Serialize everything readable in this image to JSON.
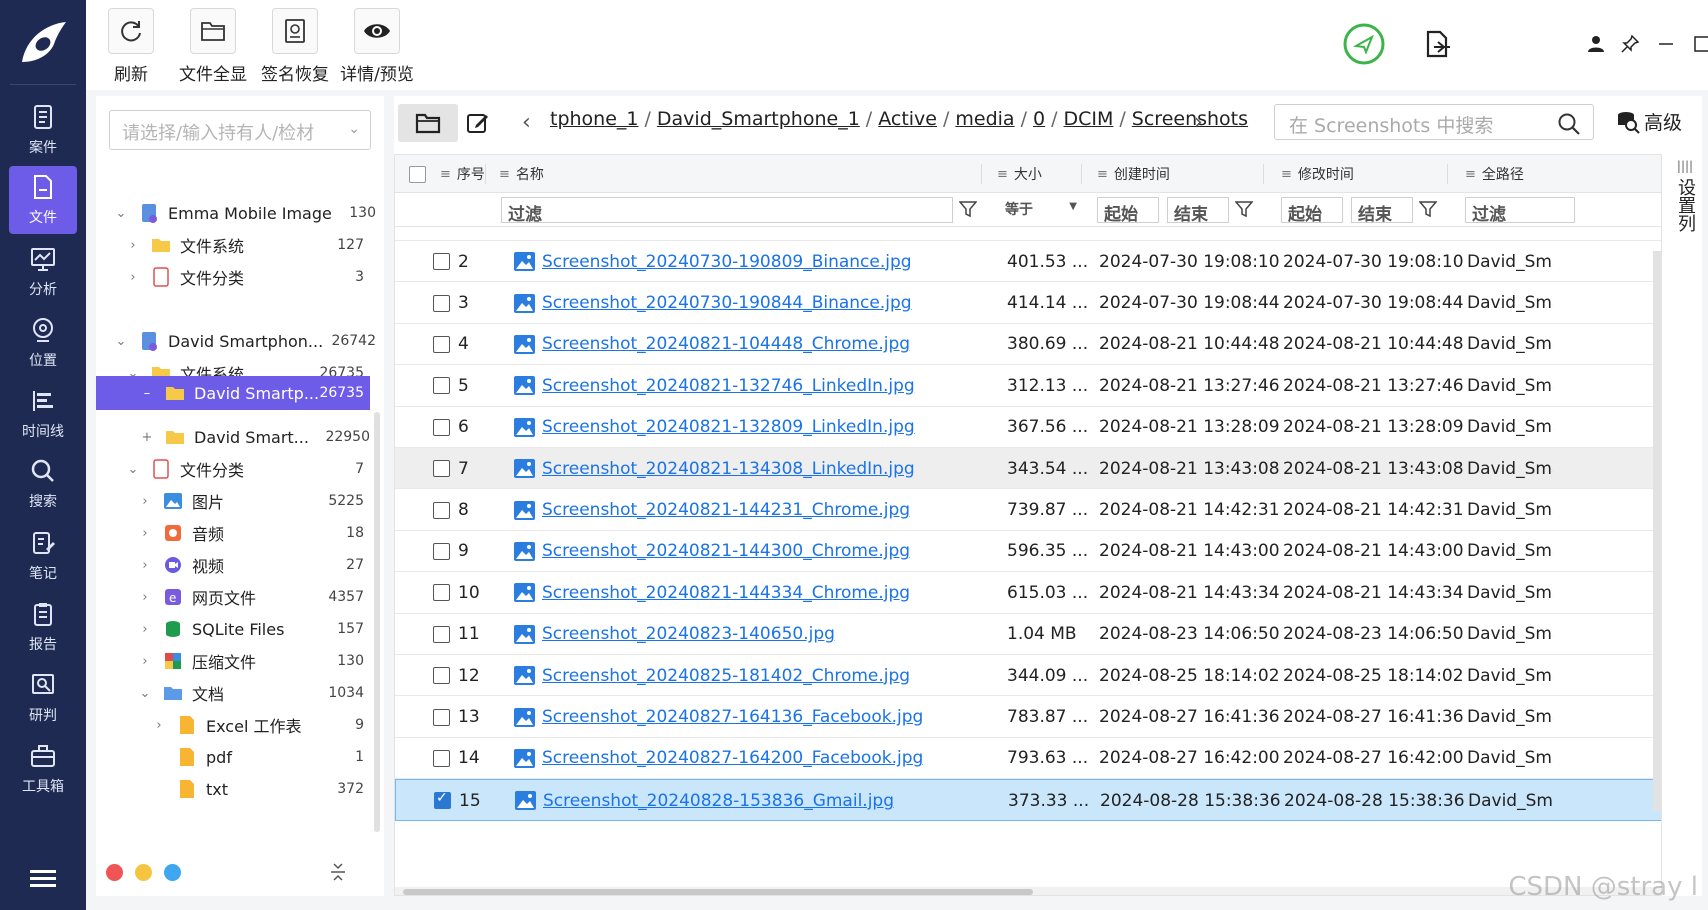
{
  "nav": {
    "items": [
      {
        "label": "案件",
        "icon": "document-icon"
      },
      {
        "label": "文件",
        "icon": "file-icon",
        "active": true
      },
      {
        "label": "分析",
        "icon": "analysis-icon"
      },
      {
        "label": "位置",
        "icon": "location-icon"
      },
      {
        "label": "时间线",
        "icon": "timeline-icon"
      },
      {
        "label": "搜索",
        "icon": "search-icon"
      },
      {
        "label": "笔记",
        "icon": "note-icon"
      },
      {
        "label": "报告",
        "icon": "report-icon"
      },
      {
        "label": "研判",
        "icon": "judge-icon"
      },
      {
        "label": "工具箱",
        "icon": "toolbox-icon"
      }
    ]
  },
  "toolbar": {
    "refresh_label": "刷新",
    "file_overview_label": "文件全显",
    "signature_recover_label": "签名恢复",
    "detail_preview_label": "详情/预览"
  },
  "tree": {
    "search_placeholder": "请选择/输入持有人/检材",
    "nodes": [
      {
        "label": "Emma Mobile Image",
        "count": "130"
      },
      {
        "label": "文件系统",
        "count": "127"
      },
      {
        "label": "文件分类",
        "count": "3"
      },
      {
        "label": "David Smartphon...",
        "count": "26742"
      },
      {
        "label": "文件系统",
        "count": "26735"
      },
      {
        "label": "David Smartp...",
        "count": "26735"
      },
      {
        "label": "David Smart...",
        "count": "22950"
      },
      {
        "label": "文件分类",
        "count": "7"
      },
      {
        "label": "图片",
        "count": "5225"
      },
      {
        "label": "音频",
        "count": "18"
      },
      {
        "label": "视频",
        "count": "27"
      },
      {
        "label": "网页文件",
        "count": "4357"
      },
      {
        "label": "SQLite Files",
        "count": "157"
      },
      {
        "label": "压缩文件",
        "count": "130"
      },
      {
        "label": "文档",
        "count": "1034"
      },
      {
        "label": "Excel 工作表",
        "count": "9"
      },
      {
        "label": "pdf",
        "count": "1"
      },
      {
        "label": "txt",
        "count": "372"
      }
    ],
    "dot_colors": [
      "#f05454",
      "#f5c542",
      "#3ea7f0"
    ]
  },
  "path": {
    "crumbs": [
      "tphone_1",
      "David_Smartphone_1",
      "Active",
      "media",
      "0",
      "DCIM",
      "Screenshots"
    ],
    "search_placeholder": "在 Screenshots 中搜索",
    "advanced_label": "高级"
  },
  "table": {
    "headers": {
      "index": "序号",
      "name": "名称",
      "size": "大小",
      "created": "创建时间",
      "modified": "修改时间",
      "path": "全路径"
    },
    "filter": {
      "name": "过滤",
      "size_op": "等于",
      "start": "起始",
      "end": "结束",
      "start2": "起始",
      "end2": "结束",
      "path": "过滤"
    },
    "rows": [
      {
        "idx": "2",
        "name": "Screenshot_20240730-190809_Binance.jpg",
        "size": "401.53 ...",
        "created": "2024-07-30 19:08:10",
        "modified": "2024-07-30 19:08:10",
        "path": "David_Smar"
      },
      {
        "idx": "3",
        "name": "Screenshot_20240730-190844_Binance.jpg",
        "size": "414.14 ...",
        "created": "2024-07-30 19:08:44",
        "modified": "2024-07-30 19:08:44",
        "path": "David_Smar"
      },
      {
        "idx": "4",
        "name": "Screenshot_20240821-104448_Chrome.jpg",
        "size": "380.69 ...",
        "created": "2024-08-21 10:44:48",
        "modified": "2024-08-21 10:44:48",
        "path": "David_Smar"
      },
      {
        "idx": "5",
        "name": "Screenshot_20240821-132746_LinkedIn.jpg",
        "size": "312.13 ...",
        "created": "2024-08-21 13:27:46",
        "modified": "2024-08-21 13:27:46",
        "path": "David_Smar"
      },
      {
        "idx": "6",
        "name": "Screenshot_20240821-132809_LinkedIn.jpg",
        "size": "367.56 ...",
        "created": "2024-08-21 13:28:09",
        "modified": "2024-08-21 13:28:09",
        "path": "David_Smar"
      },
      {
        "idx": "7",
        "name": "Screenshot_20240821-134308_LinkedIn.jpg",
        "size": "343.54 ...",
        "created": "2024-08-21 13:43:08",
        "modified": "2024-08-21 13:43:08",
        "path": "David_Smar"
      },
      {
        "idx": "8",
        "name": "Screenshot_20240821-144231_Chrome.jpg",
        "size": "739.87 ...",
        "created": "2024-08-21 14:42:31",
        "modified": "2024-08-21 14:42:31",
        "path": "David_Smar"
      },
      {
        "idx": "9",
        "name": "Screenshot_20240821-144300_Chrome.jpg",
        "size": "596.35 ...",
        "created": "2024-08-21 14:43:00",
        "modified": "2024-08-21 14:43:00",
        "path": "David_Smar"
      },
      {
        "idx": "10",
        "name": "Screenshot_20240821-144334_Chrome.jpg",
        "size": "615.03 ...",
        "created": "2024-08-21 14:43:34",
        "modified": "2024-08-21 14:43:34",
        "path": "David_Smar"
      },
      {
        "idx": "11",
        "name": "Screenshot_20240823-140650.jpg",
        "size": "1.04 MB",
        "created": "2024-08-23 14:06:50",
        "modified": "2024-08-23 14:06:50",
        "path": "David_Smar"
      },
      {
        "idx": "12",
        "name": "Screenshot_20240825-181402_Chrome.jpg",
        "size": "344.09 ...",
        "created": "2024-08-25 18:14:02",
        "modified": "2024-08-25 18:14:02",
        "path": "David_Smar"
      },
      {
        "idx": "13",
        "name": "Screenshot_20240827-164136_Facebook.jpg",
        "size": "783.87 ...",
        "created": "2024-08-27 16:41:36",
        "modified": "2024-08-27 16:41:36",
        "path": "David_Smar"
      },
      {
        "idx": "14",
        "name": "Screenshot_20240827-164200_Facebook.jpg",
        "size": "793.63 ...",
        "created": "2024-08-27 16:42:00",
        "modified": "2024-08-27 16:42:00",
        "path": "David_Smar"
      },
      {
        "idx": "15",
        "name": "Screenshot_20240828-153836_Gmail.jpg",
        "size": "373.33 ...",
        "created": "2024-08-28 15:38:36",
        "modified": "2024-08-28 15:38:36",
        "path": "David_Smar"
      }
    ]
  },
  "settings_col_label": "设置列",
  "watermark": "CSDN @stray l"
}
